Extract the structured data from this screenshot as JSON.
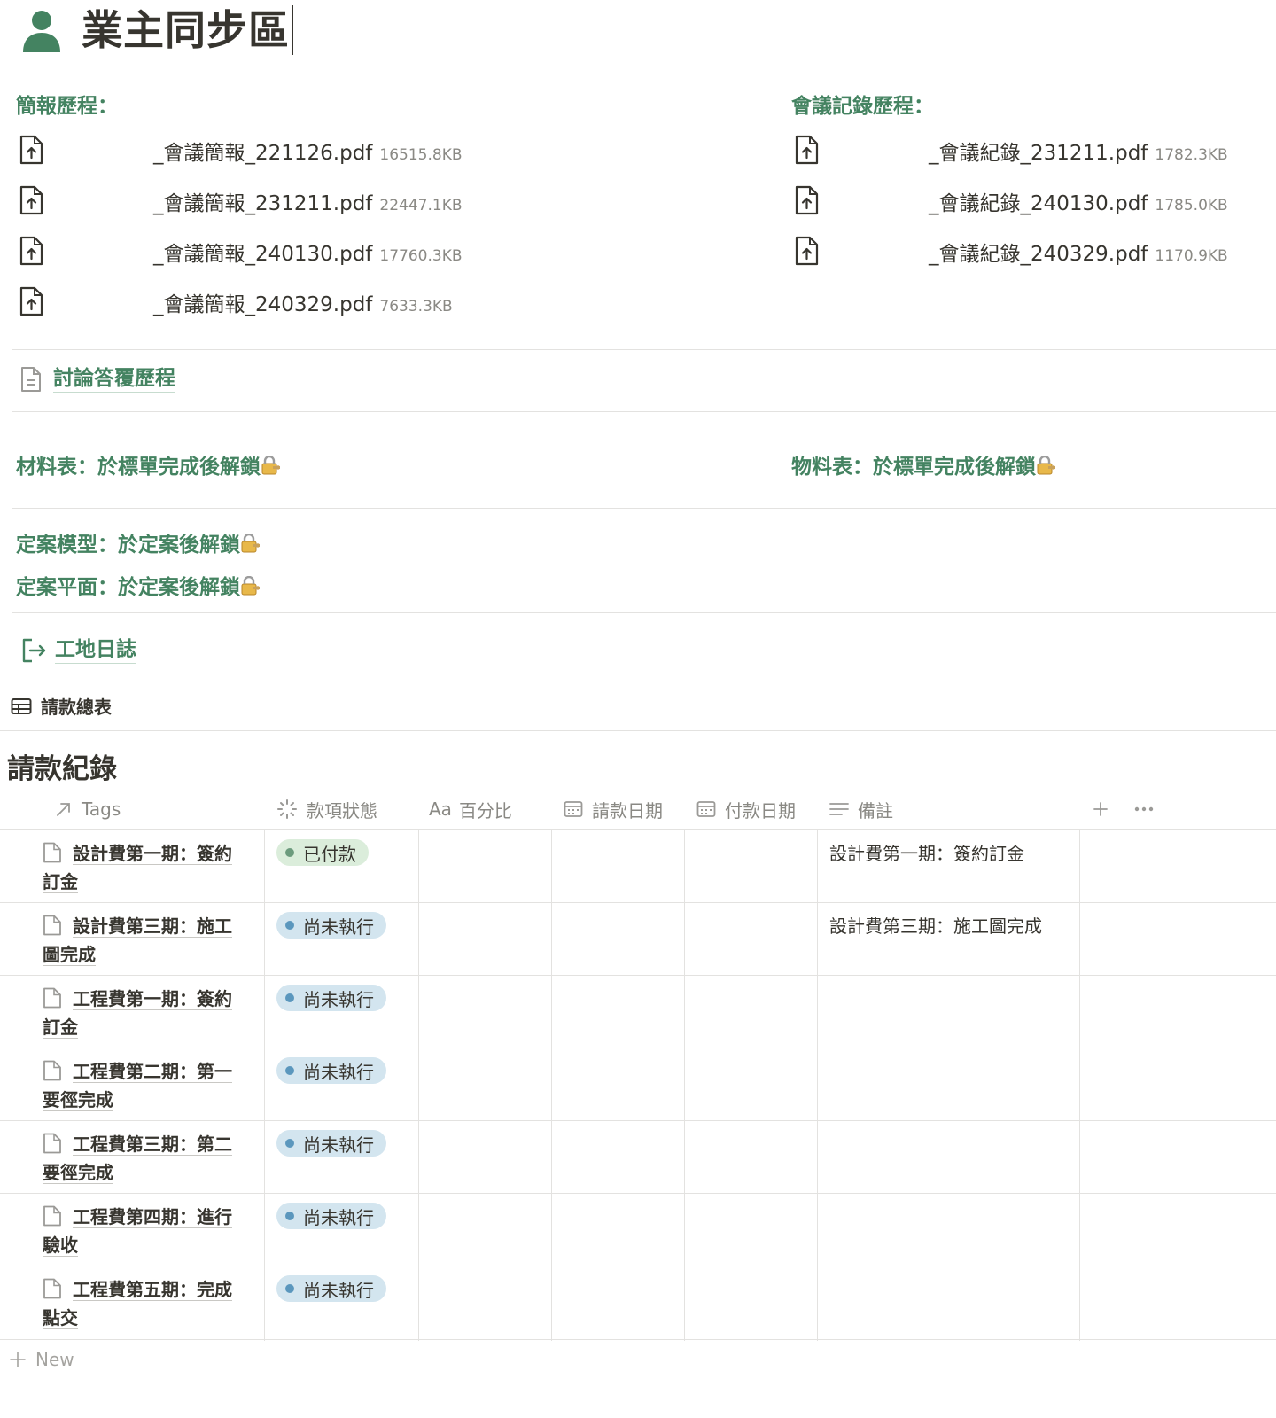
{
  "page": {
    "title": "業主同步區"
  },
  "briefings": {
    "heading": "簡報歷程：",
    "files": [
      {
        "name": "_會議簡報_221126.pdf",
        "size": "16515.8KB"
      },
      {
        "name": "_會議簡報_231211.pdf",
        "size": "22447.1KB"
      },
      {
        "name": "_會議簡報_240130.pdf",
        "size": "17760.3KB"
      },
      {
        "name": "_會議簡報_240329.pdf",
        "size": "7633.3KB"
      }
    ]
  },
  "minutes": {
    "heading": "會議記錄歷程：",
    "files": [
      {
        "name": "_會議紀錄_231211.pdf",
        "size": "1782.3KB"
      },
      {
        "name": "_會議紀錄_240130.pdf",
        "size": "1785.0KB"
      },
      {
        "name": "_會議紀錄_240329.pdf",
        "size": "1170.9KB"
      }
    ]
  },
  "links": {
    "discussion": "討論答覆歷程",
    "site_log": "工地日誌"
  },
  "locked": {
    "materials": "材料表：於標單完成後解鎖",
    "supplies": "物料表：於標單完成後解鎖",
    "final_model": "定案模型：於定案後解鎖",
    "final_plan": "定案平面：於定案後解鎖"
  },
  "view": {
    "tab_label": "請款總表"
  },
  "database": {
    "title": "請款紀錄",
    "columns": {
      "tags": "Tags",
      "status": "款項狀態",
      "percent": "百分比",
      "percent_prefix": "Aa",
      "request_date": "請款日期",
      "pay_date": "付款日期",
      "note": "備註"
    },
    "rows": [
      {
        "name_l1": "設計費第一期：簽約",
        "name_l2": "訂金",
        "status": "已付款",
        "note": "設計費第一期：簽約訂金"
      },
      {
        "name_l1": "設計費第三期：施工",
        "name_l2": "圖完成",
        "status": "尚未執行",
        "note": "設計費第三期：施工圖完成"
      },
      {
        "name_l1": "工程費第一期：簽約",
        "name_l2": "訂金",
        "status": "尚未執行",
        "note": ""
      },
      {
        "name_l1": "工程費第二期：第一",
        "name_l2": "要徑完成",
        "status": "尚未執行",
        "note": ""
      },
      {
        "name_l1": "工程費第三期：第二",
        "name_l2": "要徑完成",
        "status": "尚未執行",
        "note": ""
      },
      {
        "name_l1": "工程費第四期：進行",
        "name_l2": "驗收",
        "status": "尚未執行",
        "note": ""
      },
      {
        "name_l1": "工程費第五期：完成",
        "name_l2": "點交",
        "status": "尚未執行",
        "note": ""
      }
    ],
    "new_label": "New"
  },
  "colors": {
    "accent_green": "#448361",
    "paid_pill": "#dbeddb",
    "pending_pill": "#d3e5ef"
  }
}
